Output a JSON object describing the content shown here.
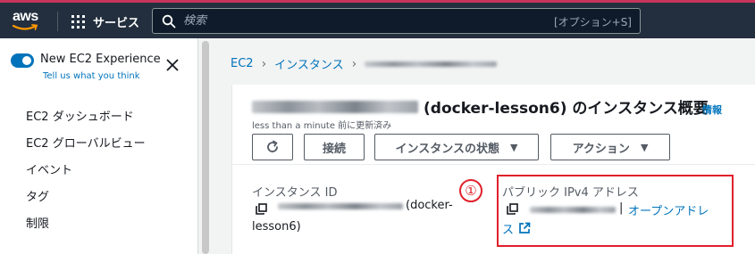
{
  "topnav": {
    "logo_text": "aws",
    "services_label": "サービス",
    "search_placeholder": "検索",
    "search_shortcut": "[オプション+S]"
  },
  "sidebar": {
    "new_experience_label": "New EC2 Experience",
    "feedback_link": "Tell us what you think",
    "toggle_on": true,
    "items": [
      {
        "label": "EC2 ダッシュボード"
      },
      {
        "label": "EC2 グローバルビュー"
      },
      {
        "label": "イベント"
      },
      {
        "label": "タグ"
      },
      {
        "label": "制限"
      }
    ]
  },
  "breadcrumb": {
    "items": [
      "EC2",
      "インスタンス"
    ]
  },
  "instance": {
    "title_suffix": "(docker-lesson6) のインスタンス概要",
    "info_link": "情報",
    "updated": "less than a minute 前に更新済み",
    "buttons": {
      "connect": "接続",
      "state": "インスタンスの状態",
      "actions": "アクション"
    },
    "id_label": "インスタンス ID",
    "id_suffix_1": "(docker-",
    "id_suffix_2": "lesson6)",
    "public_ip_label": "パブリック IPv4 アドレス",
    "open_address_1": "オープンアドレ",
    "open_address_2": "ス"
  },
  "annotation": {
    "marker": "①",
    "color": "#e0202b"
  },
  "colors": {
    "nav_bg": "#232f3e",
    "accent": "#0073bb",
    "annotation": "#e0202b"
  }
}
